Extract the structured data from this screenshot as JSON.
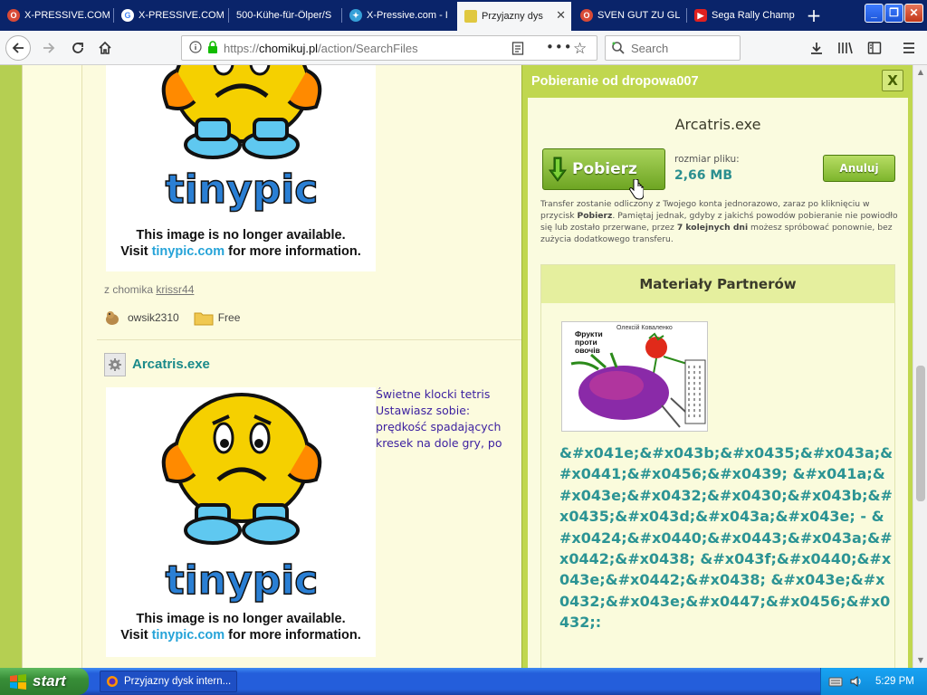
{
  "browser": {
    "tabs": [
      {
        "label": "X-PRESSIVE.COM",
        "icon": "opera-icon",
        "color": "#d84a36"
      },
      {
        "label": "X-PRESSIVE.COM",
        "icon": "google-icon",
        "color": "#ffffff"
      },
      {
        "label": "500-Kühe-für-Ölper/S",
        "icon": "blank-page-icon",
        "color": "#3a64c8"
      },
      {
        "label": "X-Pressive.com - I",
        "icon": "puzzle-icon",
        "color": "#36a0d8"
      },
      {
        "label": "Przyjazny dys",
        "icon": "chomikuj-icon",
        "color": "#e0c840",
        "active": true
      },
      {
        "label": "SVEN GUT ZU GL",
        "icon": "opera-icon",
        "color": "#d84a36"
      },
      {
        "label": "Sega Rally Champ",
        "icon": "youtube-icon",
        "color": "#e02020"
      }
    ],
    "url_prefix": "https://",
    "url_domain": "chomikuj.pl",
    "url_path": "/action/SearchFiles",
    "search_placeholder": "Search"
  },
  "page": {
    "tinypic_line1": "This image is no longer available.",
    "tinypic_line2_pre": "Visit ",
    "tinypic_line2_link": "tinypic.com",
    "tinypic_line2_post": " for more information.",
    "from_label": "z chomika",
    "from_user": "krissr44",
    "owner_name": "owsik2310",
    "folder_name": "Free",
    "file_title": "Arcatris.exe",
    "description_lines": [
      "Świetne klocki tetris",
      "Ustawiasz sobie:",
      "prędkość spadających",
      "kresek na dole gry, po"
    ]
  },
  "dialog": {
    "title": "Pobieranie od dropowa007",
    "close_label": "X",
    "filename": "Arcatris.exe",
    "download_label": "Pobierz",
    "size_label": "rozmiar pliku:",
    "size_value": "2,66 MB",
    "cancel_label": "Anuluj",
    "info_part1": "Transfer zostanie odliczony z Twojego konta jednorazowo, zaraz po kliknięciu w przycisk ",
    "info_bold1": "Pobierz",
    "info_part2": ". Pamiętaj jednak, gdyby z jakichś powodów pobieranie nie powiodło się lub zostało przerwane, przez ",
    "info_bold2": "7 kolejnych dni",
    "info_part3": " możesz spróbować ponownie, bez zużycia dodatkowego transferu.",
    "partners_heading": "Materiały Partnerów",
    "book_author": "Олексій Коваленко",
    "book_title_lines": [
      "Фрукти",
      "проти",
      "овочів"
    ],
    "partner_text": "&#x041e;&#x043b;&#x0435;&#x043a;&#x0441;&#x0456;&#x0439; &#x041a;&#x043e;&#x0432;&#x0430;&#x043b;&#x0435;&#x043d;&#x043a;&#x043e; - &#x0424;&#x0440;&#x0443;&#x043a;&#x0442;&#x0438; &#x043f;&#x0440;&#x043e;&#x0442;&#x0438; &#x043e;&#x0432;&#x043e;&#x0447;&#x0456;&#x0432;:"
  },
  "taskbar": {
    "start_label": "start",
    "task_label": "Przyjazny dysk intern...",
    "clock": "5:29 PM"
  },
  "colors": {
    "page_background": "#b5cf52",
    "dialog_header": "#c0d74f",
    "accent_teal": "#2b8f8f",
    "button_green": "#6ea523"
  }
}
